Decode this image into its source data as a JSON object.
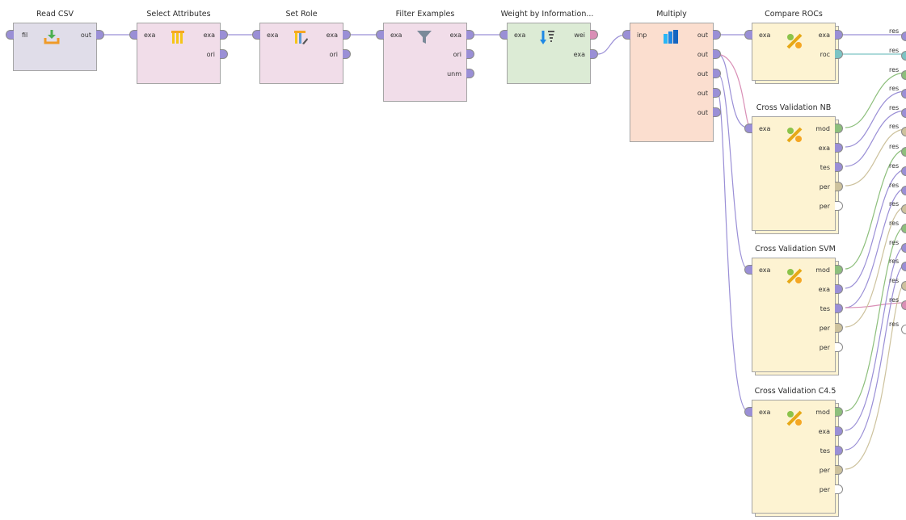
{
  "operators": {
    "read_csv": {
      "title": "Read CSV",
      "in_ports": [
        "fil"
      ],
      "out_ports": [
        "out"
      ]
    },
    "select_attributes": {
      "title": "Select Attributes",
      "in_ports": [
        "exa"
      ],
      "out_ports": [
        "exa",
        "ori"
      ]
    },
    "set_role": {
      "title": "Set Role",
      "in_ports": [
        "exa"
      ],
      "out_ports": [
        "exa",
        "ori"
      ]
    },
    "filter_examples": {
      "title": "Filter Examples",
      "in_ports": [
        "exa"
      ],
      "out_ports": [
        "exa",
        "ori",
        "unm"
      ]
    },
    "weight_by_information": {
      "title": "Weight by Information...",
      "in_ports": [
        "exa"
      ],
      "out_ports": [
        "wei",
        "exa"
      ]
    },
    "multiply": {
      "title": "Multiply",
      "in_ports": [
        "inp"
      ],
      "out_ports": [
        "out",
        "out",
        "out",
        "out",
        "out"
      ]
    },
    "compare_rocs": {
      "title": "Compare ROCs",
      "in_ports": [
        "exa"
      ],
      "out_ports": [
        "exa",
        "roc"
      ]
    },
    "cv_nb": {
      "title": "Cross Validation NB",
      "in_ports": [
        "exa"
      ],
      "out_ports": [
        "mod",
        "exa",
        "tes",
        "per",
        "per"
      ]
    },
    "cv_svm": {
      "title": "Cross Validation SVM",
      "in_ports": [
        "exa"
      ],
      "out_ports": [
        "mod",
        "exa",
        "tes",
        "per",
        "per"
      ]
    },
    "cv_c45": {
      "title": "Cross Validation C4.5",
      "in_ports": [
        "exa"
      ],
      "out_ports": [
        "mod",
        "exa",
        "tes",
        "per",
        "per"
      ]
    }
  },
  "results": {
    "label": "res"
  },
  "colors": {
    "example_port": "#9a8fd6",
    "weight_port": "#d98fb6",
    "roc_port": "#7cc4c4",
    "model_port": "#8dbf7c",
    "performance_port": "#cdc29d",
    "wire_example": "#9a8fd6",
    "wire_model": "#8dbf7c",
    "wire_roc": "#7cc4c4",
    "wire_perf": "#cdc29d",
    "wire_weight": "#d98fb6"
  }
}
